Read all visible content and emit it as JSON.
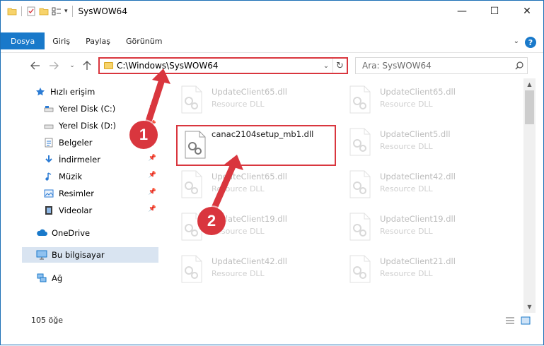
{
  "window": {
    "title": "SysWOW64",
    "controls": {
      "minimize": "—",
      "maximize": "☐",
      "close": "✕"
    }
  },
  "ribbon": {
    "tabs": [
      "Dosya",
      "Giriş",
      "Paylaş",
      "Görünüm"
    ],
    "help": "?"
  },
  "address": {
    "path": "C:\\Windows\\SysWOW64",
    "search_placeholder": "Ara: SysWOW64"
  },
  "navpane": {
    "items": [
      {
        "label": "Hızlı erişim",
        "icon": "star-icon",
        "pinned": false
      },
      {
        "label": "Yerel Disk (C:)",
        "icon": "drive-icon",
        "pinned": true
      },
      {
        "label": "Yerel Disk (D:)",
        "icon": "drive-icon",
        "pinned": true
      },
      {
        "label": "Belgeler",
        "icon": "documents-icon",
        "pinned": true
      },
      {
        "label": "İndirmeler",
        "icon": "download-icon",
        "pinned": true
      },
      {
        "label": "Müzik",
        "icon": "music-icon",
        "pinned": true
      },
      {
        "label": "Resimler",
        "icon": "pictures-icon",
        "pinned": true
      },
      {
        "label": "Videolar",
        "icon": "videos-icon",
        "pinned": true
      },
      {
        "label": "OneDrive",
        "icon": "cloud-icon",
        "pinned": false
      },
      {
        "label": "Bu bilgisayar",
        "icon": "computer-icon",
        "pinned": false
      },
      {
        "label": "Ağ",
        "icon": "network-icon",
        "pinned": false
      }
    ]
  },
  "files": [
    {
      "name": "UpdateClient65.dll",
      "desc": "Resource DLL"
    },
    {
      "name": "UpdateClient65.dll",
      "desc": "Resource DLL"
    },
    {
      "name": "canac2104setup_mb1.dll",
      "desc": ""
    },
    {
      "name": "UpdateClient5.dll",
      "desc": "Resource DLL"
    },
    {
      "name": "UpdateClient65.dll",
      "desc": "Resource DLL"
    },
    {
      "name": "UpdateClient42.dll",
      "desc": "Resource DLL"
    },
    {
      "name": "UpdateClient19.dll",
      "desc": "Resource DLL"
    },
    {
      "name": "UpdateClient19.dll",
      "desc": "Resource DLL"
    },
    {
      "name": "UpdateClient42.dll",
      "desc": "Resource DLL"
    },
    {
      "name": "UpdateClient21.dll",
      "desc": "Resource DLL"
    }
  ],
  "status": {
    "count": "105 öğe"
  },
  "annotations": {
    "badge1": "1",
    "badge2": "2"
  },
  "colors": {
    "accent": "#1979ca",
    "highlight": "#d9363e",
    "selected": "#d9e4f1"
  }
}
